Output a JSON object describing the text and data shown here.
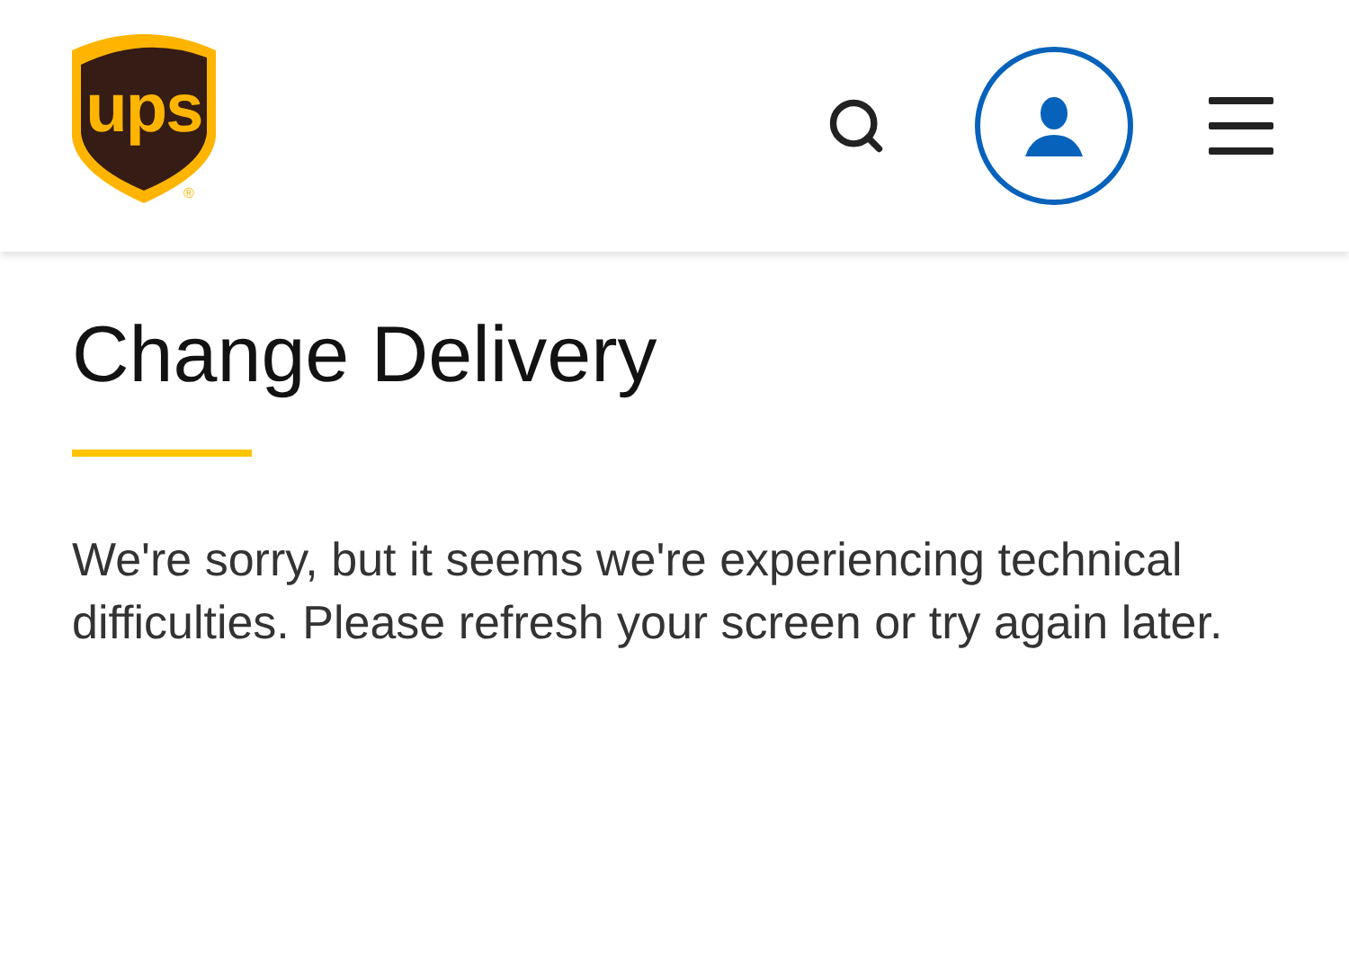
{
  "header": {
    "logo_text": "ups",
    "logo_mark": "®"
  },
  "page": {
    "title": "Change Delivery",
    "message": "We're sorry, but it seems we're experiencing technical difficulties. Please refresh your screen or try again later."
  }
}
